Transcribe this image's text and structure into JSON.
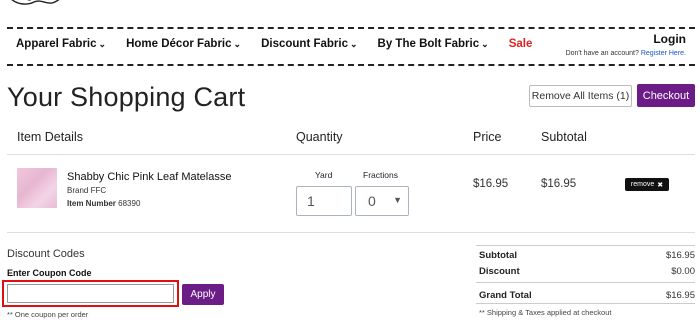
{
  "nav": {
    "items": [
      {
        "label": "Apparel Fabric",
        "chevron": "⌄"
      },
      {
        "label": "Home Décor Fabric",
        "chevron": "⌄"
      },
      {
        "label": "Discount Fabric",
        "chevron": "⌄"
      },
      {
        "label": "By The Bolt Fabric",
        "chevron": "⌄"
      },
      {
        "label": "Sale",
        "chevron": ""
      }
    ],
    "login": "Login",
    "account_prompt": "Don't have an account?",
    "register": "Register Here."
  },
  "page": {
    "title": "Your Shopping Cart",
    "remove_all": "Remove All Items (1)",
    "checkout": "Checkout"
  },
  "columns": {
    "item_details": "Item Details",
    "quantity": "Quantity",
    "price": "Price",
    "subtotal": "Subtotal"
  },
  "cart_item": {
    "name": "Shabby Chic Pink Leaf Matelasse",
    "brand_label": "Brand",
    "brand": "FFC",
    "item_number_label": "Item Number",
    "item_number": "68390",
    "yard_label": "Yard",
    "fractions_label": "Fractions",
    "yard_value": "1",
    "fraction_value": "0",
    "price": "$16.95",
    "subtotal": "$16.95",
    "remove": "remove",
    "remove_icon": "✖"
  },
  "discount": {
    "title": "Discount Codes",
    "coupon_label": "Enter Coupon Code",
    "coupon_value": "",
    "apply": "Apply",
    "note": "** One coupon per order"
  },
  "summary": {
    "subtotal_label": "Subtotal",
    "subtotal": "$16.95",
    "discount_label": "Discount",
    "discount": "$0.00",
    "grand_total_label": "Grand Total",
    "grand_total": "$16.95",
    "note": "** Shipping & Taxes applied at checkout"
  },
  "colors": {
    "brand_purple": "#6b1c86",
    "sale_red": "#e02020",
    "highlight_red": "#e01010"
  }
}
